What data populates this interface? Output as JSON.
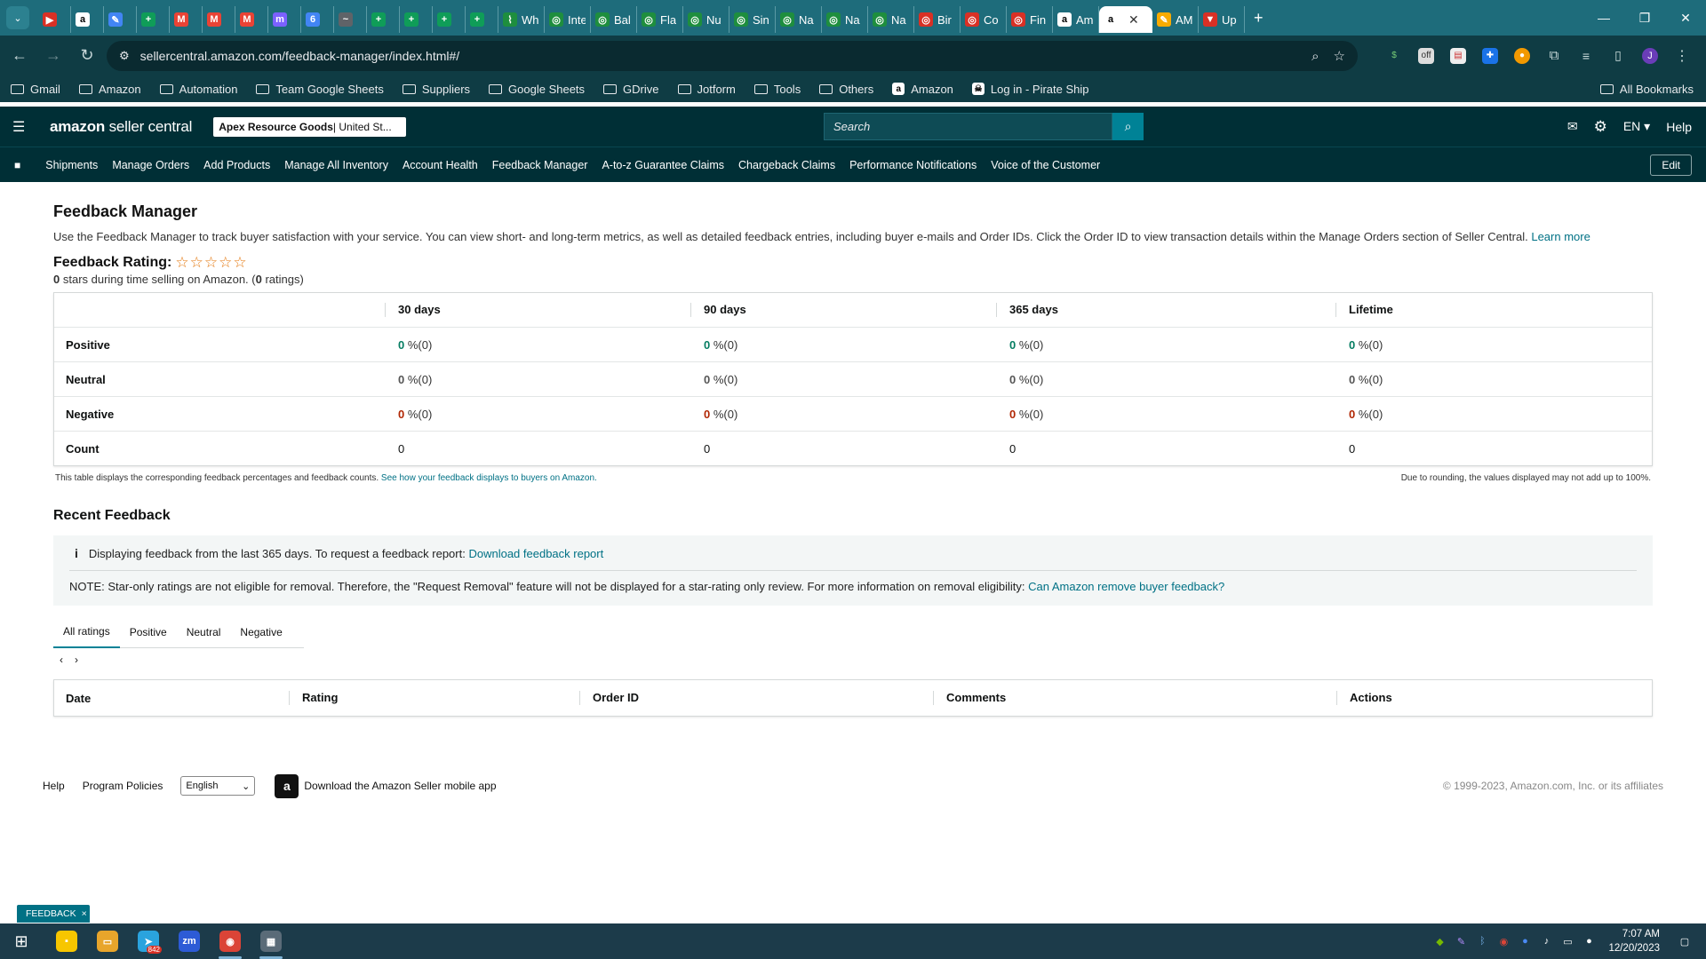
{
  "browser": {
    "tabs": [
      {
        "title": "",
        "color": "#d93025",
        "glyph": "▶"
      },
      {
        "title": "",
        "color": "#ffffff",
        "glyph": "a"
      },
      {
        "title": "",
        "color": "#4285f4",
        "glyph": "✎"
      },
      {
        "title": "",
        "color": "#0f9d58",
        "glyph": "+"
      },
      {
        "title": "",
        "color": "#ea4335",
        "glyph": "M"
      },
      {
        "title": "",
        "color": "#ea4335",
        "glyph": "M"
      },
      {
        "title": "",
        "color": "#ea4335",
        "glyph": "M"
      },
      {
        "title": "",
        "color": "#7b61ff",
        "glyph": "m"
      },
      {
        "title": "",
        "color": "#4285f4",
        "glyph": "6"
      },
      {
        "title": "",
        "color": "#5f6368",
        "glyph": "~"
      },
      {
        "title": "",
        "color": "#0f9d58",
        "glyph": "+"
      },
      {
        "title": "",
        "color": "#0f9d58",
        "glyph": "+"
      },
      {
        "title": "",
        "color": "#0f9d58",
        "glyph": "+"
      },
      {
        "title": "",
        "color": "#0f9d58",
        "glyph": "+"
      },
      {
        "title": "Wh",
        "color": "#1e8e3e",
        "glyph": "⌇"
      },
      {
        "title": "Inte",
        "color": "#1e8e3e",
        "glyph": "◎"
      },
      {
        "title": "Bal",
        "color": "#1e8e3e",
        "glyph": "◎"
      },
      {
        "title": "Fla",
        "color": "#1e8e3e",
        "glyph": "◎"
      },
      {
        "title": "Nu",
        "color": "#1e8e3e",
        "glyph": "◎"
      },
      {
        "title": "Sin",
        "color": "#1e8e3e",
        "glyph": "◎"
      },
      {
        "title": "Na",
        "color": "#1e8e3e",
        "glyph": "◎"
      },
      {
        "title": "Na",
        "color": "#1e8e3e",
        "glyph": "◎"
      },
      {
        "title": "Na",
        "color": "#1e8e3e",
        "glyph": "◎"
      },
      {
        "title": "Bir",
        "color": "#d93025",
        "glyph": "◎"
      },
      {
        "title": "Co",
        "color": "#d93025",
        "glyph": "◎"
      },
      {
        "title": "Fin",
        "color": "#d93025",
        "glyph": "◎"
      },
      {
        "title": "Am",
        "color": "#ffffff",
        "glyph": "a"
      },
      {
        "title": "",
        "color": "#ffffff",
        "glyph": "a",
        "active": true
      },
      {
        "title": "AM",
        "color": "#f9ab00",
        "glyph": "✎"
      },
      {
        "title": "Up",
        "color": "#d93025",
        "glyph": "▼"
      }
    ],
    "url": "sellercentral.amazon.com/feedback-manager/index.html#/",
    "bookmarks": [
      {
        "label": "Gmail",
        "type": "folder"
      },
      {
        "label": "Amazon",
        "type": "folder"
      },
      {
        "label": "Automation",
        "type": "folder"
      },
      {
        "label": "Team Google Sheets",
        "type": "folder"
      },
      {
        "label": "Suppliers",
        "type": "folder"
      },
      {
        "label": "Google Sheets",
        "type": "folder"
      },
      {
        "label": "GDrive",
        "type": "folder"
      },
      {
        "label": "Jotform",
        "type": "folder"
      },
      {
        "label": "Tools",
        "type": "folder"
      },
      {
        "label": "Others",
        "type": "folder"
      },
      {
        "label": "Amazon",
        "type": "site"
      },
      {
        "label": "Log in - Pirate Ship",
        "type": "site"
      }
    ],
    "all_bookmarks": "All Bookmarks",
    "profile_initial": "J"
  },
  "header": {
    "logo_bold": "amazon",
    "logo_rest": " seller central",
    "account_name": "Apex Resource Goods",
    "account_marketplace": " | United St...",
    "search_placeholder": "Search",
    "language": "EN ▾",
    "help": "Help"
  },
  "nav": {
    "items": [
      "Shipments",
      "Manage Orders",
      "Add Products",
      "Manage All Inventory",
      "Account Health",
      "Feedback Manager",
      "A-to-z Guarantee Claims",
      "Chargeback Claims",
      "Performance Notifications",
      "Voice of the Customer"
    ],
    "edit": "Edit"
  },
  "page": {
    "title": "Feedback Manager",
    "intro": "Use the Feedback Manager to track buyer satisfaction with your service. You can view short- and long-term metrics, as well as detailed feedback entries, including buyer e-mails and Order IDs. Click the Order ID to view transaction details within the Manage Orders section of Seller Central.",
    "learn_more": "Learn more",
    "rating_label": "Feedback Rating:",
    "stars": "☆☆☆☆☆",
    "rating_stars": "0",
    "rating_sub_mid": " stars during time selling on Amazon. (",
    "rating_count": "0",
    "rating_sub_end": " ratings)"
  },
  "feedback_table": {
    "columns": [
      "",
      "30 days",
      "90 days",
      "365 days",
      "Lifetime"
    ],
    "rows": [
      {
        "label": "Positive",
        "kind": "g",
        "cells": [
          "0",
          "0",
          "0",
          "0"
        ],
        "suffix": " %(0)"
      },
      {
        "label": "Neutral",
        "kind": "n",
        "cells": [
          "0",
          "0",
          "0",
          "0"
        ],
        "suffix": " %(0)"
      },
      {
        "label": "Negative",
        "kind": "r",
        "cells": [
          "0",
          "0",
          "0",
          "0"
        ],
        "suffix": " %(0)"
      },
      {
        "label": "Count",
        "kind": "plain",
        "cells": [
          "0",
          "0",
          "0",
          "0"
        ],
        "suffix": ""
      }
    ],
    "note_left": "This table displays the corresponding feedback percentages and feedback counts.",
    "note_link": "See how your feedback displays to buyers on Amazon.",
    "note_right": "Due to rounding, the values displayed may not add up to 100%."
  },
  "recent": {
    "title": "Recent Feedback",
    "info_text": "Displaying feedback from the last 365 days. To request a feedback report:",
    "info_link": "Download feedback report",
    "note_text": "NOTE: Star-only ratings are not eligible for removal. Therefore, the \"Request Removal\" feature will not be displayed for a star-rating only review. For more information on removal eligibility:",
    "note_link": "Can Amazon remove buyer feedback?",
    "tabs": [
      "All ratings",
      "Positive",
      "Neutral",
      "Negative"
    ],
    "columns": [
      "Date",
      "Rating",
      "Order ID",
      "Comments",
      "Actions"
    ]
  },
  "footer": {
    "help": "Help",
    "policies": "Program Policies",
    "language": "English",
    "app": "Download the Amazon Seller mobile app",
    "copyright": "© 1999-2023, Amazon.com, Inc. or its affiliates"
  },
  "feedback_tab": "FEEDBACK",
  "taskbar": {
    "apps": [
      {
        "name": "sticky-notes",
        "color": "#f7c600",
        "glyph": "▪"
      },
      {
        "name": "file-explorer",
        "color": "#e8a52b",
        "glyph": "▭"
      },
      {
        "name": "telegram",
        "color": "#2aa3de",
        "glyph": "➤",
        "badge": "842"
      },
      {
        "name": "zoom",
        "color": "#2d5bd6",
        "glyph": "zm"
      },
      {
        "name": "chrome",
        "color": "#db4437",
        "glyph": "◉",
        "active": true
      },
      {
        "name": "calculator",
        "color": "#5a6b78",
        "glyph": "▦",
        "active": true
      }
    ],
    "time": "7:07 AM",
    "date": "12/20/2023"
  }
}
